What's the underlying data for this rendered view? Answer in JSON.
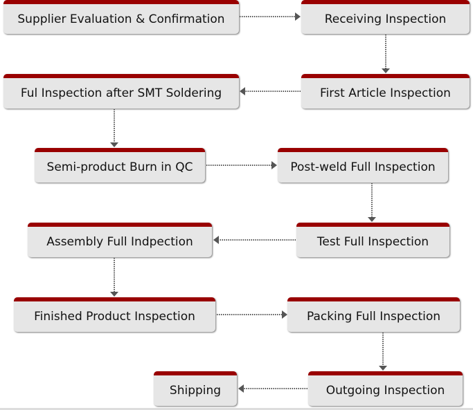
{
  "steps": [
    "Supplier Evaluation & Confirmation",
    "Receiving Inspection",
    "First Article Inspection",
    "Ful Inspection after SMT Soldering",
    "Semi-product Burn in QC",
    "Post-weld Full Inspection",
    "Test Full Inspection",
    "Assembly Full Indpection",
    "Finished Product Inspection",
    "Packing Full Inspection",
    "Outgoing Inspection",
    "Shipping"
  ],
  "colors": {
    "header": "#990000",
    "box": "#e6e6e6",
    "connector": "#555555"
  }
}
